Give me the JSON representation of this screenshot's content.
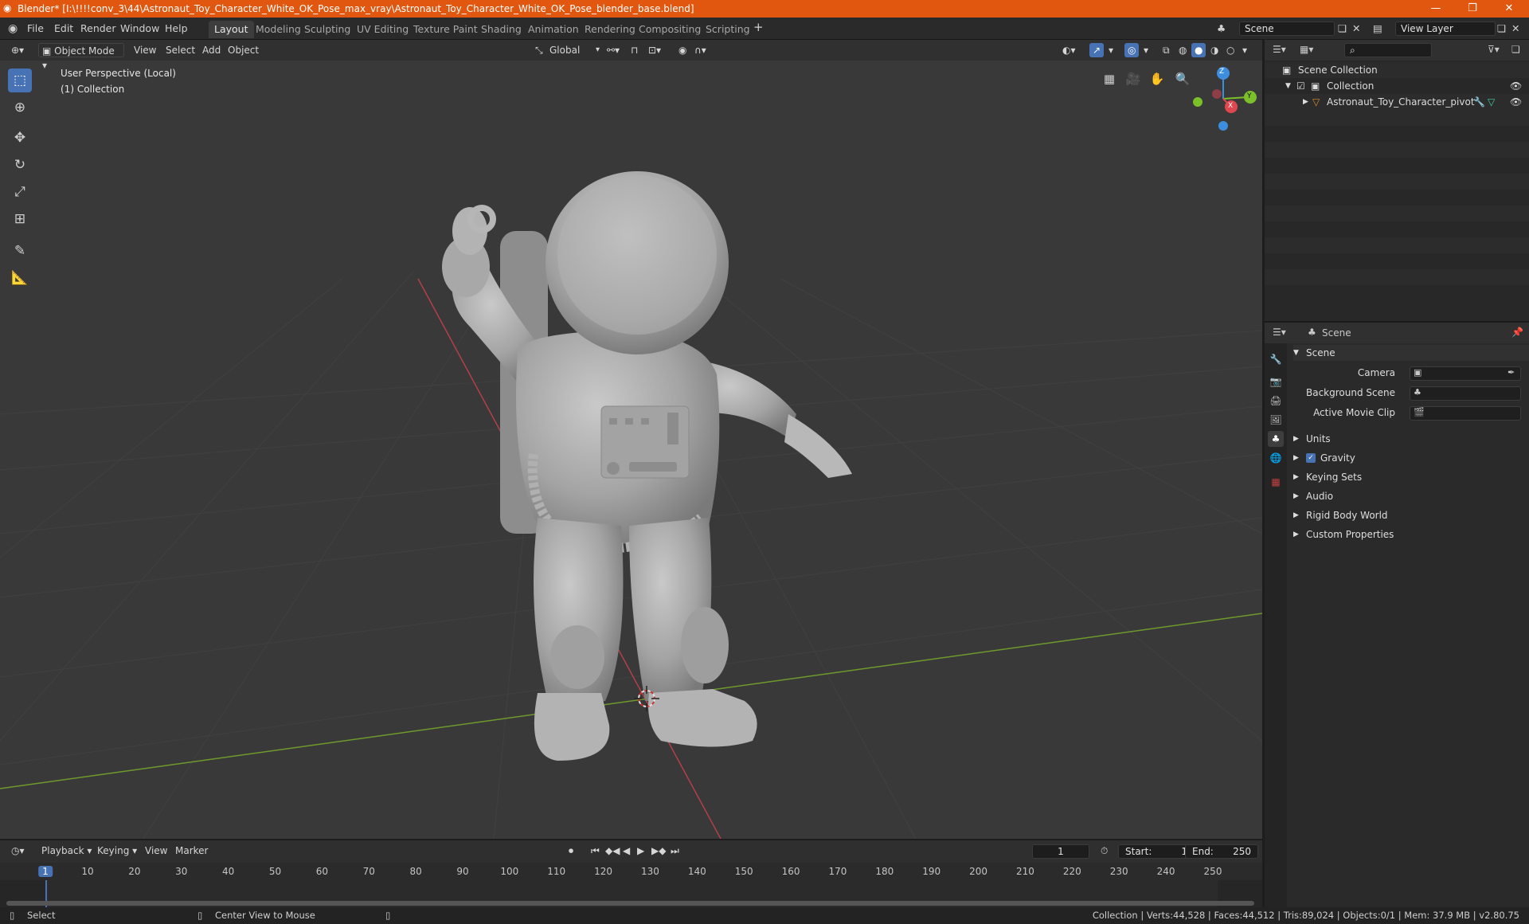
{
  "titlebar": {
    "title": "Blender* [I:\\!!!!conv_3\\44\\Astronaut_Toy_Character_White_OK_Pose_max_vray\\Astronaut_Toy_Character_White_OK_Pose_blender_base.blend]",
    "minimize": "—",
    "restore": "❐",
    "close": "✕"
  },
  "menu": {
    "file": "File",
    "edit": "Edit",
    "render": "Render",
    "window": "Window",
    "help": "Help"
  },
  "workspaces": [
    "Layout",
    "Modeling",
    "Sculpting",
    "UV Editing",
    "Texture Paint",
    "Shading",
    "Animation",
    "Rendering",
    "Compositing",
    "Scripting"
  ],
  "active_workspace": "Layout",
  "scene_selector": {
    "value": "Scene"
  },
  "view_layer_selector": {
    "value": "View Layer"
  },
  "viewport": {
    "mode": "Object Mode",
    "view_menu": "View",
    "select_menu": "Select",
    "add_menu": "Add",
    "object_menu": "Object",
    "transform_orientation": "Global",
    "perspective_label": "User Perspective (Local)",
    "collection_label": "(1) Collection",
    "gizmo": {
      "z": "Z",
      "y": "Y",
      "x": "X"
    }
  },
  "outliner": {
    "scene_collection": "Scene Collection",
    "collection": "Collection",
    "object": "Astronaut_Toy_Character_pivot"
  },
  "properties": {
    "header": "Scene",
    "panel_title": "Scene",
    "camera_label": "Camera",
    "background_scene_label": "Background Scene",
    "active_movie_clip_label": "Active Movie Clip",
    "sections": [
      "Units",
      "Gravity",
      "Keying Sets",
      "Audio",
      "Rigid Body World",
      "Custom Properties"
    ],
    "gravity_checked": true
  },
  "timeline": {
    "playback": "Playback",
    "keying": "Keying",
    "view": "View",
    "marker": "Marker",
    "current_frame": "1",
    "start_label": "Start:",
    "start_value": "1",
    "end_label": "End:",
    "end_value": "250",
    "frame_marks": [
      "1",
      "10",
      "20",
      "30",
      "40",
      "50",
      "60",
      "70",
      "80",
      "90",
      "100",
      "110",
      "120",
      "130",
      "140",
      "150",
      "160",
      "170",
      "180",
      "190",
      "200",
      "210",
      "220",
      "230",
      "240",
      "250"
    ]
  },
  "statusbar": {
    "select": "Select",
    "center_view": "Center View to Mouse",
    "stats": "Collection | Verts:44,528 | Faces:44,512 | Tris:89,024 | Objects:0/1 | Mem: 37.9 MB | v2.80.75"
  },
  "colors": {
    "title_bar": "#e2570f",
    "accent": "#4772b3",
    "x_axis": "#e0484f",
    "y_axis": "#7bbf2a",
    "z_axis": "#3e8ee0"
  }
}
